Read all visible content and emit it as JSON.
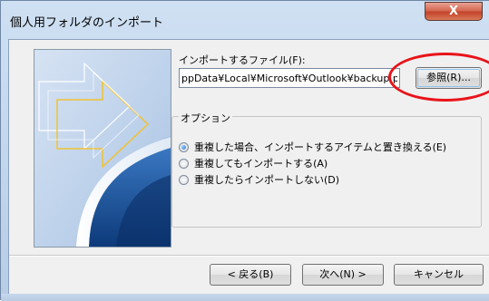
{
  "window": {
    "title": "個人用フォルダのインポート",
    "close_glyph": "X"
  },
  "import_file": {
    "label": "インポートするファイル(F):",
    "value": "ppData¥Local¥Microsoft¥Outlook¥backup.pst",
    "browse_label": "参照(R)..."
  },
  "options": {
    "legend": "オプション",
    "items": [
      {
        "label": "重複した場合、インポートするアイテムと置き換える(E)",
        "checked": true
      },
      {
        "label": "重複してもインポートする(A)",
        "checked": false
      },
      {
        "label": "重複したらインポートしない(D)",
        "checked": false
      }
    ]
  },
  "buttons": {
    "back": "< 戻る(B)",
    "next": "次へ(N) >",
    "cancel": "キャンセル"
  },
  "colors": {
    "highlight": "#e8141a",
    "art_blue": "#1f5aa8",
    "art_arrow": "#f1c232"
  }
}
